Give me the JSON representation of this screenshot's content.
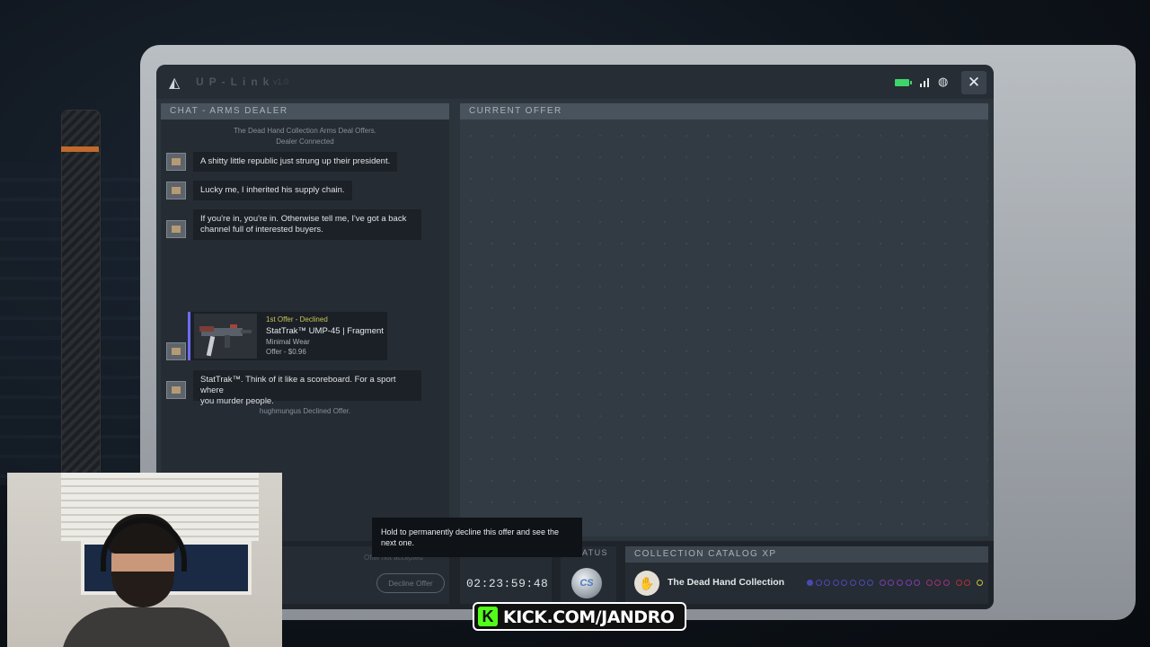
{
  "app": {
    "title": "UP-Link",
    "subtitle": "v1.0",
    "close_icon": "✕"
  },
  "chat": {
    "header": "CHAT - ARMS DEALER",
    "system_top": "The Dead Hand Collection Arms Deal Offers.",
    "system_connected": "Dealer Connected",
    "messages": [
      "A shitty little republic just strung up their president.",
      "Lucky me, I inherited his supply chain.",
      "If you're in, you're in. Otherwise tell me, I've got a back",
      "channel full of interested buyers.",
      "StatTrak™. Think of it like a scoreboard. For a sport where",
      "you murder people."
    ],
    "offer": {
      "status": "1st Offer - Declined",
      "item": "StatTrak™ UMP-45 | Fragment",
      "wear": "Minimal Wear",
      "price": "Offer - $0.96"
    },
    "system_declined": "hughmungus Declined Offer."
  },
  "current_offer": {
    "header": "CURRENT OFFER"
  },
  "bottom": {
    "faded_label": "Offer not accepted",
    "decline_label": "Decline Offer",
    "tooltip": "Hold to permanently decline this offer and see the next one.",
    "timer": "02:23:59:48",
    "status_header": "ATUS",
    "badge": "CS",
    "catalog_header": "COLLECTION CATALOG XP",
    "collection_name": "The Dead Hand Collection",
    "xp_progress": 0.05
  },
  "colors": {
    "accent": "#6c6cff",
    "offer_declined": "#c8c45a",
    "battery": "#3fd46a",
    "kick_green": "#53fc18"
  },
  "overlay": {
    "kick_label": "KICK.COM/JANDRO",
    "kick_logo": "K"
  }
}
